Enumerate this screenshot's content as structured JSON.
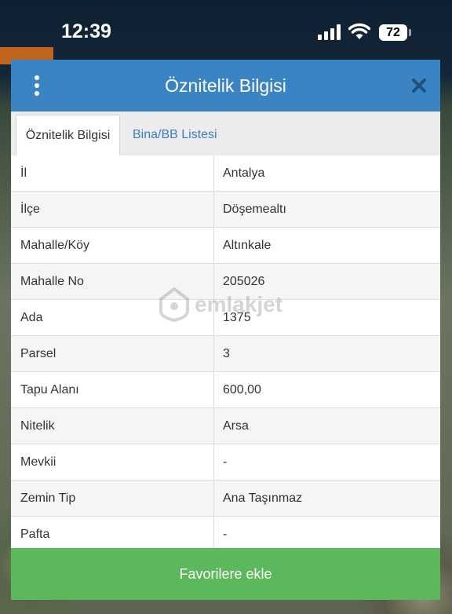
{
  "status_bar": {
    "time": "12:39",
    "battery": "72"
  },
  "dialog": {
    "title": "Öznitelik Bilgisi",
    "tabs": [
      {
        "label": "Öznitelik Bilgisi",
        "active": true
      },
      {
        "label": "Bina/BB Listesi",
        "active": false
      }
    ],
    "rows": [
      {
        "label": "İl",
        "value": "Antalya"
      },
      {
        "label": "İlçe",
        "value": "Döşemealtı"
      },
      {
        "label": "Mahalle/Köy",
        "value": "Altınkale"
      },
      {
        "label": "Mahalle No",
        "value": "205026"
      },
      {
        "label": "Ada",
        "value": "1375"
      },
      {
        "label": "Parsel",
        "value": "3"
      },
      {
        "label": "Tapu Alanı",
        "value": "600,00"
      },
      {
        "label": "Nitelik",
        "value": "Arsa"
      },
      {
        "label": "Mevkii",
        "value": "-"
      },
      {
        "label": "Zemin Tip",
        "value": "Ana Taşınmaz"
      },
      {
        "label": "Pafta",
        "value": "-"
      }
    ],
    "favorite_button": "Favorilere ekle"
  },
  "watermark": "emlakjet",
  "colors": {
    "header": "#3b84c4",
    "button": "#5cb85c",
    "link": "#3b7dbd"
  },
  "icons": [
    "signal-icon",
    "wifi-icon",
    "battery-icon",
    "menu-dots-icon",
    "close-icon",
    "emlakjet-logo-icon"
  ]
}
